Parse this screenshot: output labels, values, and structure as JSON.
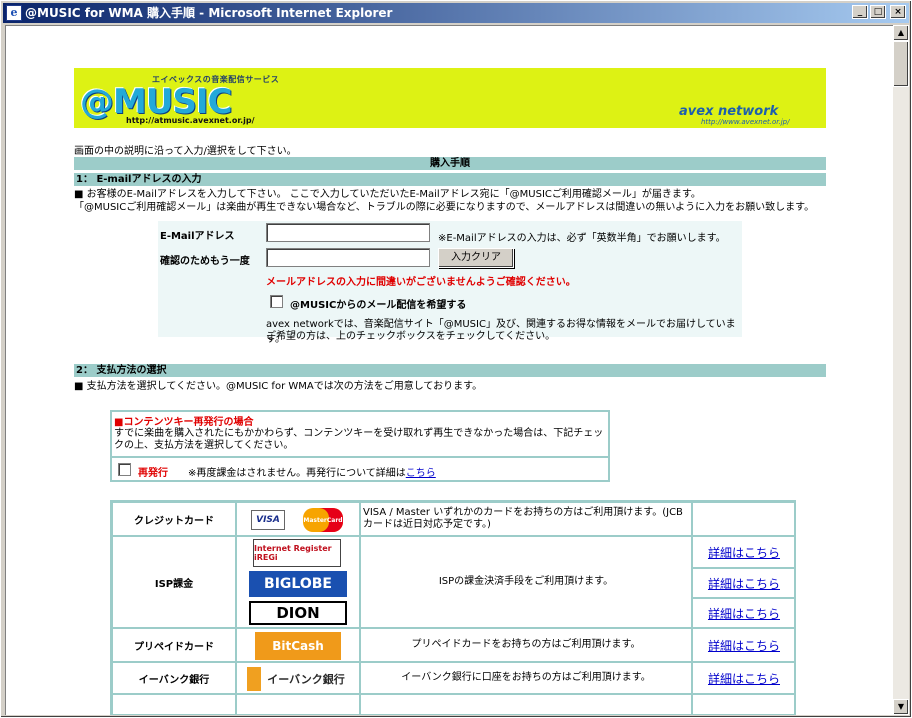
{
  "window": {
    "title": "@MUSIC for WMA 購入手順 - Microsoft Internet Explorer",
    "buttons": {
      "minimize": "_",
      "maximize": "□",
      "close": "×"
    }
  },
  "banner": {
    "logo_subtitle": "エイベックスの音楽配信サービス",
    "logo_text": "@MUSIC",
    "logo_url": "http://atmusic.avexnet.or.jp/",
    "avex_logo": "avex network",
    "avex_url": "http://www.avexnet.or.jp/"
  },
  "intro": "画面の中の説明に沿って入力/選択をして下さい。",
  "purchase_header": "購入手順",
  "section1": {
    "title": "1： E-mailアドレスの入力",
    "note1": "■ お客様のE-Mailアドレスを入力して下さい。 ここで入力していただいたE-Mailアドレス宛に「@MUSICご利用確認メール」が届きます。",
    "note2": "「@MUSICご利用確認メール」は楽曲が再生できない場合など、トラブルの際に必要になりますので、メールアドレスは間違いの無いように入力をお願い致します。",
    "email_label": "E-Mailアドレス",
    "email_value": "",
    "email_hint": "※E-Mailアドレスの入力は、必ず「英数半角」でお願いします。",
    "confirm_label": "確認のためもう一度",
    "confirm_value": "",
    "clear_button": "入力クリア",
    "warning": "メールアドレスの入力に間違いがございませんようご確認ください。",
    "newsletter_label": "@MUSICからのメール配信を希望する",
    "newsletter_desc1": "avex networkでは、音楽配信サイト「@MUSIC」及び、関連するお得な情報をメールでお届けしています。",
    "newsletter_desc2": "ご希望の方は、上のチェックボックスをチェックしてください。"
  },
  "section2": {
    "title": "2： 支払方法の選択",
    "note": "■ 支払方法を選択してください。@MUSIC for WMAでは次の方法をご用意しております。"
  },
  "reissue": {
    "heading": "■コンテンツキー再発行の場合",
    "body": "すでに楽曲を購入されたにもかかわらず、コンテンツキーを受け取れず再生できなかった場合は、下記チェックの上、支払方法を選択してください。",
    "checkbox_label": "再発行",
    "note": "※再度課金はされません。再発行について詳細は",
    "link": "こちら"
  },
  "payment": {
    "credit": {
      "label": "クレジットカード",
      "logos": [
        "VISA",
        "MasterCard"
      ],
      "desc": "VISA / Master いずれかのカードをお持ちの方はご利用頂けます。(JCBカードは近日対応予定です。)"
    },
    "isp": {
      "label": "ISP課金",
      "logos": [
        "Internet Register iREGi",
        "BIGLOBE",
        "DION"
      ],
      "desc": "ISPの課金決済手段をご利用頂けます。",
      "links": [
        "詳細はこちら",
        "詳細はこちら",
        "詳細はこちら"
      ]
    },
    "prepaid": {
      "label": "プリペイドカード",
      "logo": "BitCash",
      "desc": "プリペイドカードをお持ちの方はご利用頂けます。",
      "link": "詳細はこちら"
    },
    "ebank": {
      "label": "イーバンク銀行",
      "logo": "イーバンク銀行",
      "desc": "イーバンク銀行に口座をお持ちの方はご利用頂けます。",
      "link": "詳細はこちら"
    }
  },
  "colors": {
    "section_bar": "#9cccc9",
    "banner": "#ddf214",
    "warning": "#e00000",
    "link": "#0000cc",
    "title_bar": "#0a246a"
  }
}
